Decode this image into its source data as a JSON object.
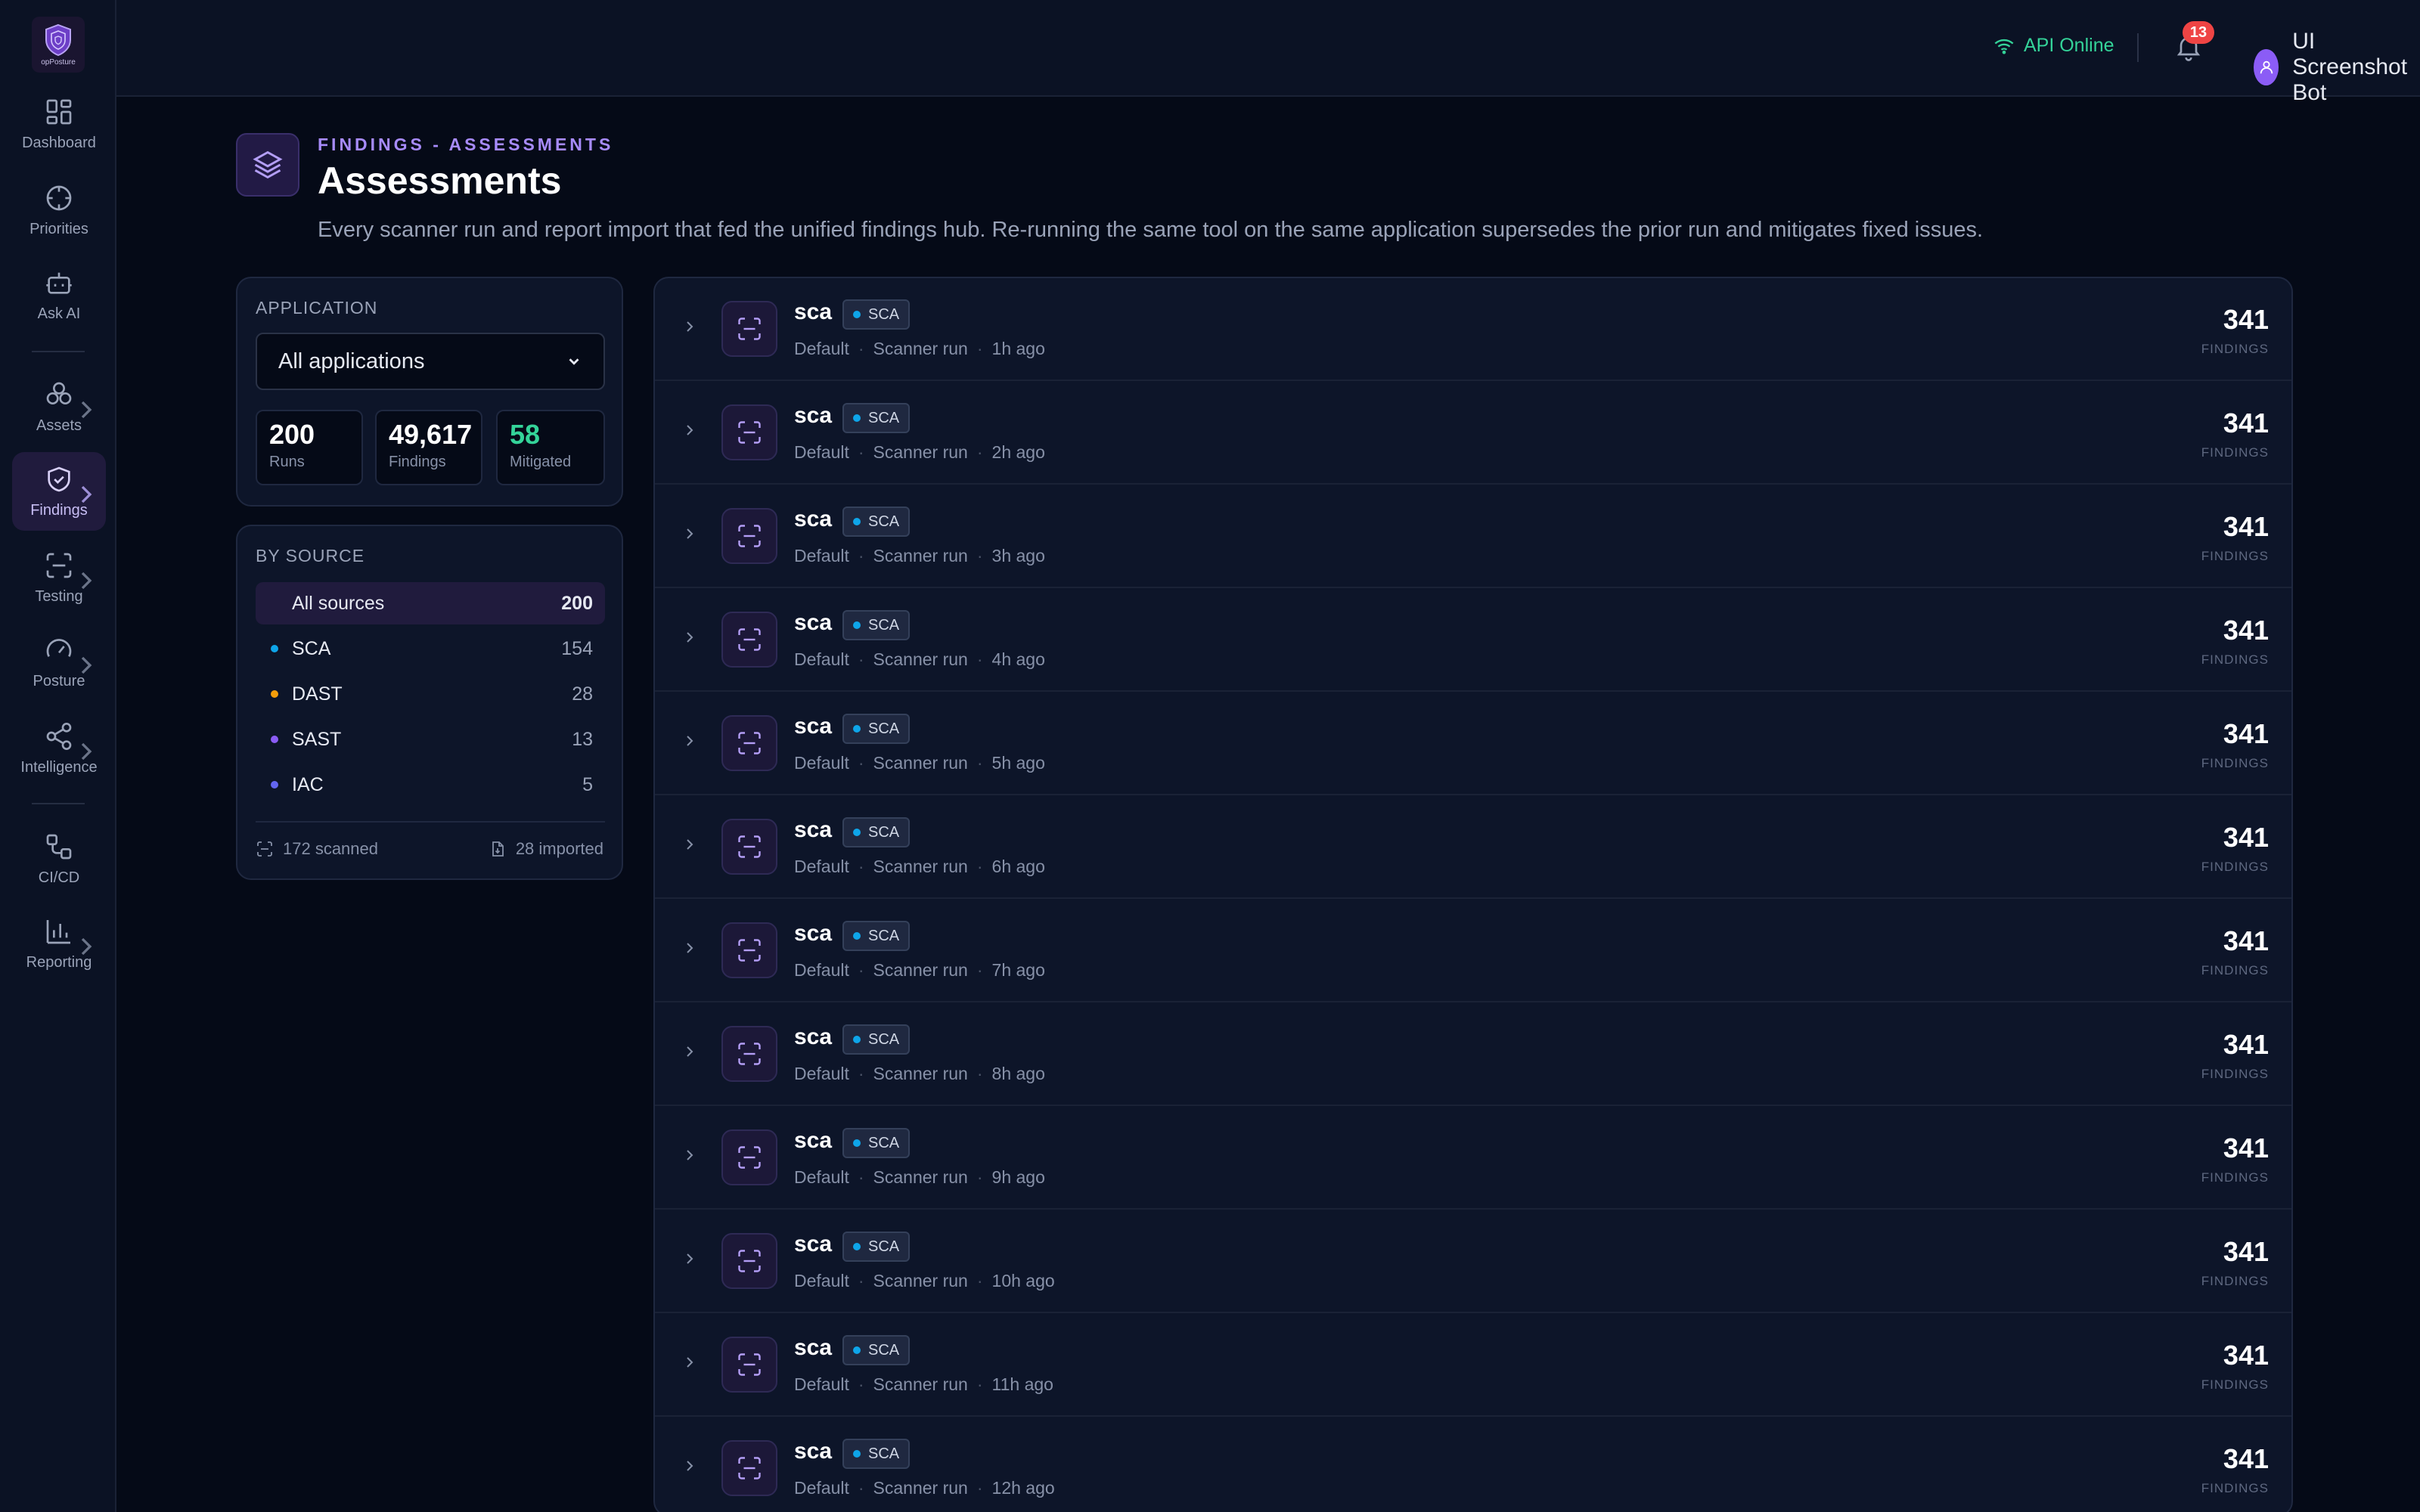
{
  "sidebar": {
    "logo_text": "opPosture",
    "items": [
      {
        "label": "Dashboard",
        "icon": "grid-icon"
      },
      {
        "label": "Priorities",
        "icon": "crosshair-icon"
      },
      {
        "label": "Ask AI",
        "icon": "bot-icon"
      },
      {
        "label": "Assets",
        "icon": "boxes-icon"
      },
      {
        "label": "Findings",
        "icon": "shield-check-icon"
      },
      {
        "label": "Testing",
        "icon": "scan-icon"
      },
      {
        "label": "Posture",
        "icon": "gauge-icon"
      },
      {
        "label": "Intelligence",
        "icon": "share-icon"
      },
      {
        "label": "CI/CD",
        "icon": "workflow-icon"
      },
      {
        "label": "Reporting",
        "icon": "bar-chart-icon"
      }
    ],
    "active": "Findings"
  },
  "topbar": {
    "api_status": "API Online",
    "notifications_count": "13",
    "user_name": "UI Screenshot Bot"
  },
  "header": {
    "eyebrow": "FINDINGS - ASSESSMENTS",
    "title": "Assessments",
    "description": "Every scanner run and report import that fed the unified findings hub. Re-running the same tool on the same application supersedes the prior run and mitigates fixed issues."
  },
  "filters": {
    "application_label": "APPLICATION",
    "application_value": "All applications",
    "stats": [
      {
        "value": "200",
        "label": "Runs"
      },
      {
        "value": "49,617",
        "label": "Findings"
      },
      {
        "value": "58",
        "label": "Mitigated"
      }
    ],
    "by_source_label": "BY SOURCE",
    "sources": [
      {
        "name": "All sources",
        "count": "200"
      },
      {
        "name": "SCA",
        "count": "154"
      },
      {
        "name": "DAST",
        "count": "28"
      },
      {
        "name": "SAST",
        "count": "13"
      },
      {
        "name": "IAC",
        "count": "5"
      }
    ],
    "scanned": "172 scanned",
    "imported": "28 imported"
  },
  "runs": [
    {
      "name": "sca",
      "badge": "SCA",
      "app": "Default",
      "type": "Scanner run",
      "time": "1h ago",
      "count": "341",
      "count_label": "FINDINGS"
    },
    {
      "name": "sca",
      "badge": "SCA",
      "app": "Default",
      "type": "Scanner run",
      "time": "2h ago",
      "count": "341",
      "count_label": "FINDINGS"
    },
    {
      "name": "sca",
      "badge": "SCA",
      "app": "Default",
      "type": "Scanner run",
      "time": "3h ago",
      "count": "341",
      "count_label": "FINDINGS"
    },
    {
      "name": "sca",
      "badge": "SCA",
      "app": "Default",
      "type": "Scanner run",
      "time": "4h ago",
      "count": "341",
      "count_label": "FINDINGS"
    },
    {
      "name": "sca",
      "badge": "SCA",
      "app": "Default",
      "type": "Scanner run",
      "time": "5h ago",
      "count": "341",
      "count_label": "FINDINGS"
    },
    {
      "name": "sca",
      "badge": "SCA",
      "app": "Default",
      "type": "Scanner run",
      "time": "6h ago",
      "count": "341",
      "count_label": "FINDINGS"
    },
    {
      "name": "sca",
      "badge": "SCA",
      "app": "Default",
      "type": "Scanner run",
      "time": "7h ago",
      "count": "341",
      "count_label": "FINDINGS"
    },
    {
      "name": "sca",
      "badge": "SCA",
      "app": "Default",
      "type": "Scanner run",
      "time": "8h ago",
      "count": "341",
      "count_label": "FINDINGS"
    },
    {
      "name": "sca",
      "badge": "SCA",
      "app": "Default",
      "type": "Scanner run",
      "time": "9h ago",
      "count": "341",
      "count_label": "FINDINGS"
    },
    {
      "name": "sca",
      "badge": "SCA",
      "app": "Default",
      "type": "Scanner run",
      "time": "10h ago",
      "count": "341",
      "count_label": "FINDINGS"
    },
    {
      "name": "sca",
      "badge": "SCA",
      "app": "Default",
      "type": "Scanner run",
      "time": "11h ago",
      "count": "341",
      "count_label": "FINDINGS"
    },
    {
      "name": "sca",
      "badge": "SCA",
      "app": "Default",
      "type": "Scanner run",
      "time": "12h ago",
      "count": "341",
      "count_label": "FINDINGS"
    }
  ],
  "colors": {
    "accent": "#a78bfa",
    "sca": "#0ea5e9",
    "dast": "#f59e0b",
    "sast": "#8b5cf6",
    "iac": "#6366f1",
    "online": "#34d399",
    "badge": "#ef4444"
  }
}
